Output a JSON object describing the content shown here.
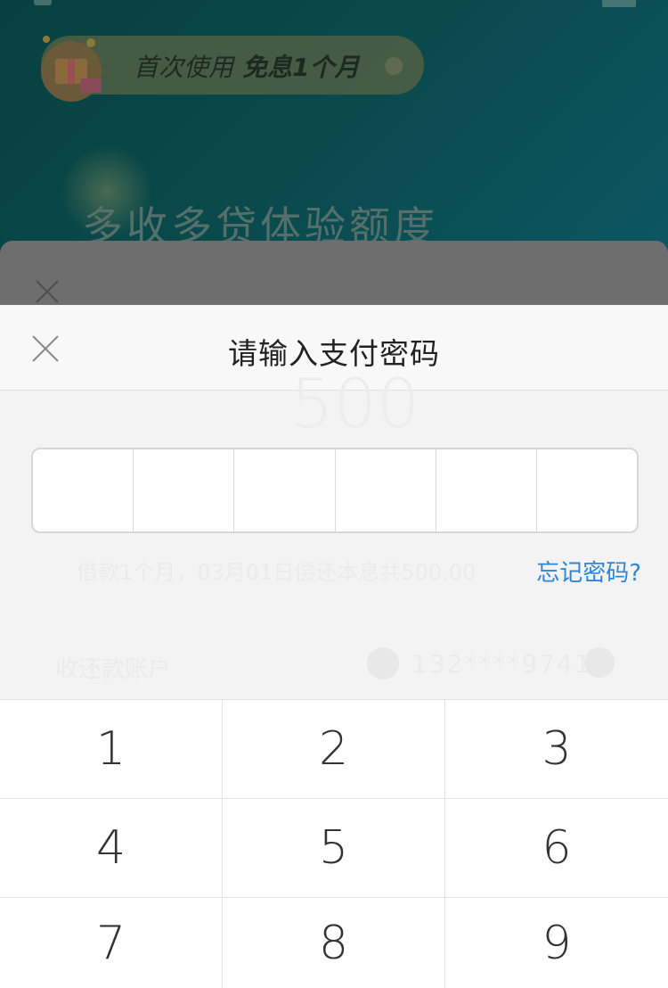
{
  "background": {
    "promo": {
      "prefix": "首次使用",
      "highlight": "免息1个月"
    },
    "hero_title": "多收多贷体验额度",
    "amount": "500",
    "repay_info": "借款1个月，03月01日偿还本息共500.00",
    "account_label": "收还款账户",
    "account_phone": "132****9741"
  },
  "dialog": {
    "title": "请输入支付密码",
    "forgot_link": "忘记密码?",
    "pin_length": 6
  },
  "keypad": {
    "keys": [
      "1",
      "2",
      "3",
      "4",
      "5",
      "6",
      "7",
      "8",
      "9"
    ]
  },
  "colors": {
    "hero_bg": "#0a4a4d",
    "link": "#2f86d2",
    "dialog_bg": "#f3f3f3",
    "keypad_bg": "#ffffff"
  }
}
